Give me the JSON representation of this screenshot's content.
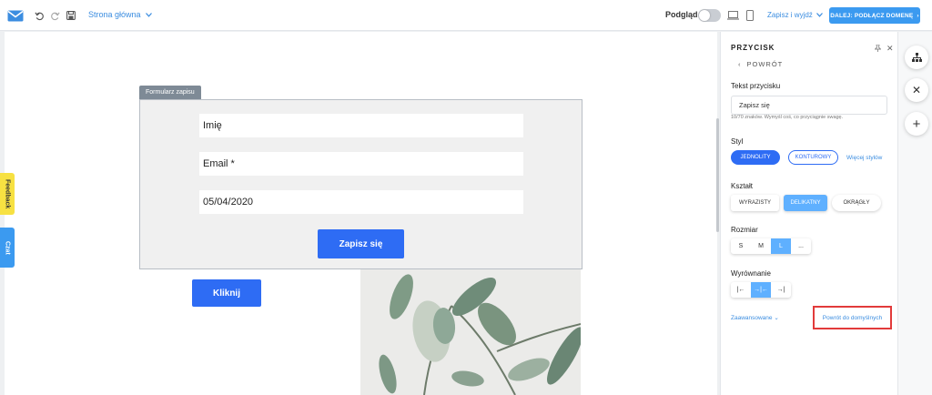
{
  "topbar": {
    "page_selector": "Strona główna",
    "preview_label": "Podgląd",
    "save_exit": "Zapisz i wyjdź",
    "next_button": "DALEJ: PODŁĄCZ DOMENĘ"
  },
  "canvas": {
    "form_tag": "Formularz zapisu",
    "fields": [
      "Imię",
      "Email *",
      "05/04/2020"
    ],
    "submit_label": "Zapisz się",
    "click_label": "Kliknij"
  },
  "side_tabs": {
    "feedback": "Feedback",
    "chat": "Czat"
  },
  "panel": {
    "title": "PRZYCISK",
    "back": "POWRÓT",
    "text_label": "Tekst przycisku",
    "text_value": "Zapisz się",
    "hint": "10/70 znaków. Wymyśl coś, co przyciągnie swagę.",
    "style_label": "Styl",
    "style_solid": "JEDNOLITY",
    "style_outline": "KONTUROWY",
    "more_styles": "Więcej stylów",
    "shape_label": "Kształt",
    "shapes": [
      "WYRAZISTY",
      "DELIKATNY",
      "OKRĄGŁY"
    ],
    "size_label": "Rozmiar",
    "sizes": [
      "S",
      "M",
      "L",
      "..."
    ],
    "align_label": "Wyrównanie",
    "alignments": [
      "|←",
      "→|←",
      "→|"
    ],
    "advanced": "Zaawansowane",
    "reset": "Powrót do domyślnych"
  },
  "colors": {
    "accent": "#2e6cf4",
    "link": "#3b8de0",
    "highlight": "#e23b3b"
  }
}
